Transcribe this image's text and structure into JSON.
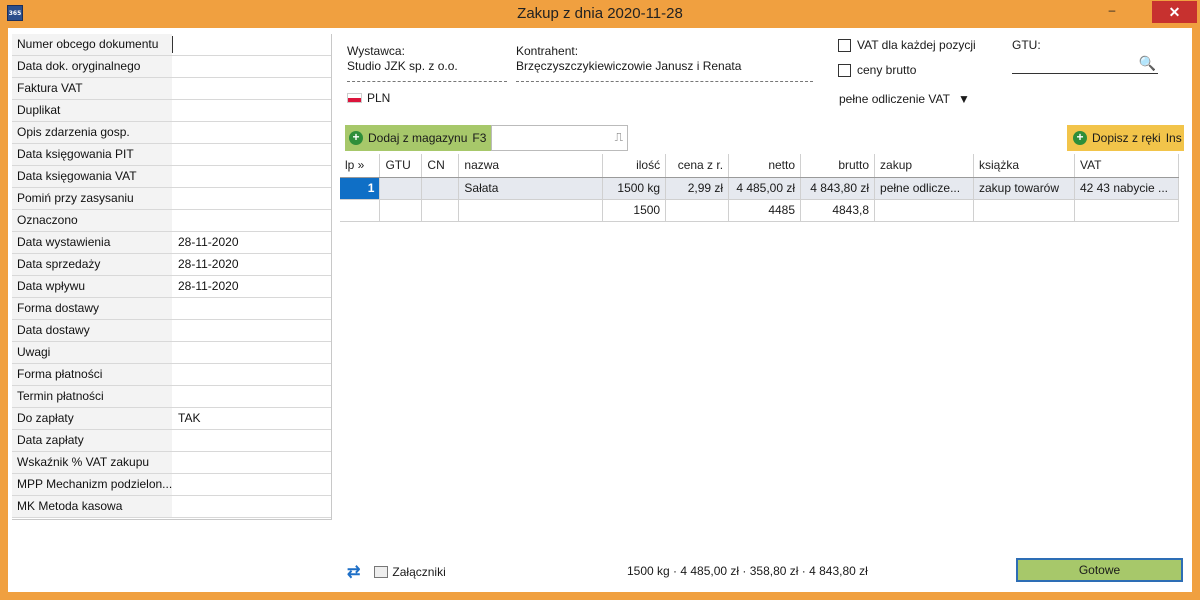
{
  "window": {
    "title": "Zakup z dnia 2020-11-28",
    "app_badge": "365",
    "minimize_glyph": "–",
    "close_glyph": "✕"
  },
  "properties": [
    {
      "label": "Numer obcego dokumentu",
      "value": ""
    },
    {
      "label": "Data dok. oryginalnego",
      "value": ""
    },
    {
      "label": "Faktura VAT",
      "value": ""
    },
    {
      "label": "Duplikat",
      "value": ""
    },
    {
      "label": "Opis zdarzenia gosp.",
      "value": ""
    },
    {
      "label": "Data księgowania PIT",
      "value": ""
    },
    {
      "label": "Data księgowania VAT",
      "value": ""
    },
    {
      "label": "Pomiń przy zasysaniu",
      "value": ""
    },
    {
      "label": "Oznaczono",
      "value": ""
    },
    {
      "label": "Data wystawienia",
      "value": "28-11-2020"
    },
    {
      "label": "Data sprzedaży",
      "value": "28-11-2020"
    },
    {
      "label": "Data wpływu",
      "value": "28-11-2020"
    },
    {
      "label": "Forma dostawy",
      "value": ""
    },
    {
      "label": "Data dostawy",
      "value": ""
    },
    {
      "label": "Uwagi",
      "value": ""
    },
    {
      "label": "Forma płatności",
      "value": ""
    },
    {
      "label": "Termin płatności",
      "value": ""
    },
    {
      "label": "Do zapłaty",
      "value": "TAK"
    },
    {
      "label": "Data zapłaty",
      "value": ""
    },
    {
      "label": "Wskaźnik % VAT zakupu",
      "value": ""
    },
    {
      "label": "MPP Mechanizm podzielon...",
      "value": ""
    },
    {
      "label": "MK Metoda kasowa",
      "value": ""
    }
  ],
  "supplier": {
    "label": "Wystawca:",
    "name": "Studio JZK sp. z o.o."
  },
  "contractor": {
    "label": "Kontrahent:",
    "name": "Brzęczyszczykiewiczowie Janusz i Renata"
  },
  "currency": {
    "code": "PLN",
    "flag_icon": "poland-flag-icon"
  },
  "options": {
    "vat_per_item": "VAT dla każdej pozycji",
    "gross_prices": "ceny brutto",
    "vat_deduction": "pełne odliczenie VAT",
    "dropdown_glyph": "▼"
  },
  "gtu": {
    "label": "GTU:",
    "value": "",
    "search_glyph": "🔍"
  },
  "toolbar": {
    "add_from_warehouse": "Dodaj z magazynu",
    "add_shortcut": "F3",
    "scan_value": "",
    "add_manual": "Dopisz z ręki",
    "manual_shortcut": "Ins",
    "plus_glyph": "+"
  },
  "table": {
    "columns": [
      "lp »",
      "GTU",
      "CN",
      "nazwa",
      "ilość",
      "cena z r.",
      "netto",
      "brutto",
      "zakup",
      "książka",
      "VAT"
    ],
    "rows": [
      [
        "1",
        "",
        "",
        "Sałata",
        "1500 kg",
        "2,99 zł",
        "4 485,00 zł",
        "4 843,80 zł",
        "pełne odlicze...",
        "zakup towarów",
        "42 43 nabycie ..."
      ],
      [
        "",
        "",
        "",
        "",
        "1500",
        "",
        "4485",
        "4843,8",
        "",
        "",
        ""
      ]
    ]
  },
  "footer": {
    "attachments": "Załączniki",
    "summary": "1500 kg · 4 485,00 zł · 358,80 zł · 4 843,80 zł",
    "done": "Gotowe",
    "refresh_glyph": "⇄"
  },
  "colors": {
    "window_frame": "#f0a040",
    "close_button": "#c7312f",
    "add_button": "#a7c86a",
    "manual_button": "#f2c44a",
    "selected_lp": "#0f6fc6"
  }
}
